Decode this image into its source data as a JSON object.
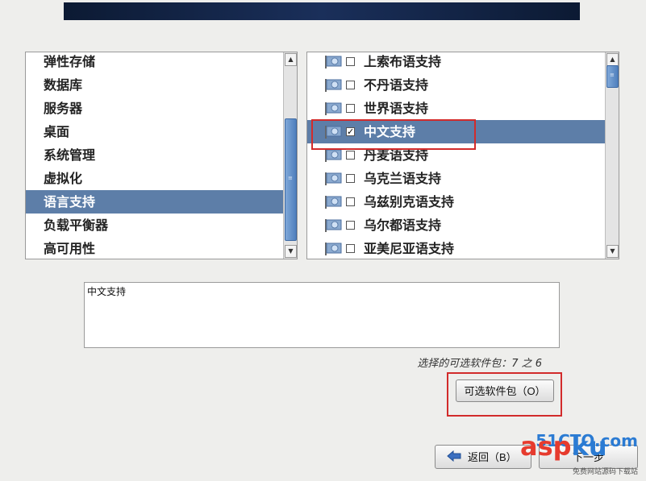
{
  "categories": [
    {
      "label": "弹性存储",
      "selected": false
    },
    {
      "label": "数据库",
      "selected": false
    },
    {
      "label": "服务器",
      "selected": false
    },
    {
      "label": "桌面",
      "selected": false
    },
    {
      "label": "系统管理",
      "selected": false
    },
    {
      "label": "虚拟化",
      "selected": false
    },
    {
      "label": "语言支持",
      "selected": true
    },
    {
      "label": "负载平衡器",
      "selected": false
    },
    {
      "label": "高可用性",
      "selected": false
    }
  ],
  "languages": [
    {
      "label": "上索布语支持",
      "checked": false,
      "selected": false
    },
    {
      "label": "不丹语支持",
      "checked": false,
      "selected": false
    },
    {
      "label": "世界语支持",
      "checked": false,
      "selected": false
    },
    {
      "label": "中文支持",
      "checked": true,
      "selected": true
    },
    {
      "label": "丹麦语支持",
      "checked": false,
      "selected": false
    },
    {
      "label": "乌克兰语支持",
      "checked": false,
      "selected": false
    },
    {
      "label": "乌兹别克语支持",
      "checked": false,
      "selected": false
    },
    {
      "label": "乌尔都语支持",
      "checked": false,
      "selected": false
    },
    {
      "label": "亚美尼亚语支持",
      "checked": false,
      "selected": false
    }
  ],
  "description": "中文支持",
  "selection_count": "选择的可选软件包：7 之 6",
  "buttons": {
    "optional_packages": "可选软件包（O）",
    "back": "返回（B）",
    "next": "下一步"
  },
  "icons": {
    "check_glyph": "✓",
    "up_arrow": "▲",
    "down_arrow": "▼",
    "grip": "≡",
    "back_arrow": "back-arrow-icon"
  },
  "watermark": {
    "site_top": "51CTO.com",
    "brand": "asp",
    "brand_suffix": "ku",
    "tagline": "免费网站源码下载站"
  },
  "colors": {
    "selection": "#5d7ea8",
    "highlight_box": "#d22b2b",
    "scroll_thumb": "#4f7fbd"
  }
}
